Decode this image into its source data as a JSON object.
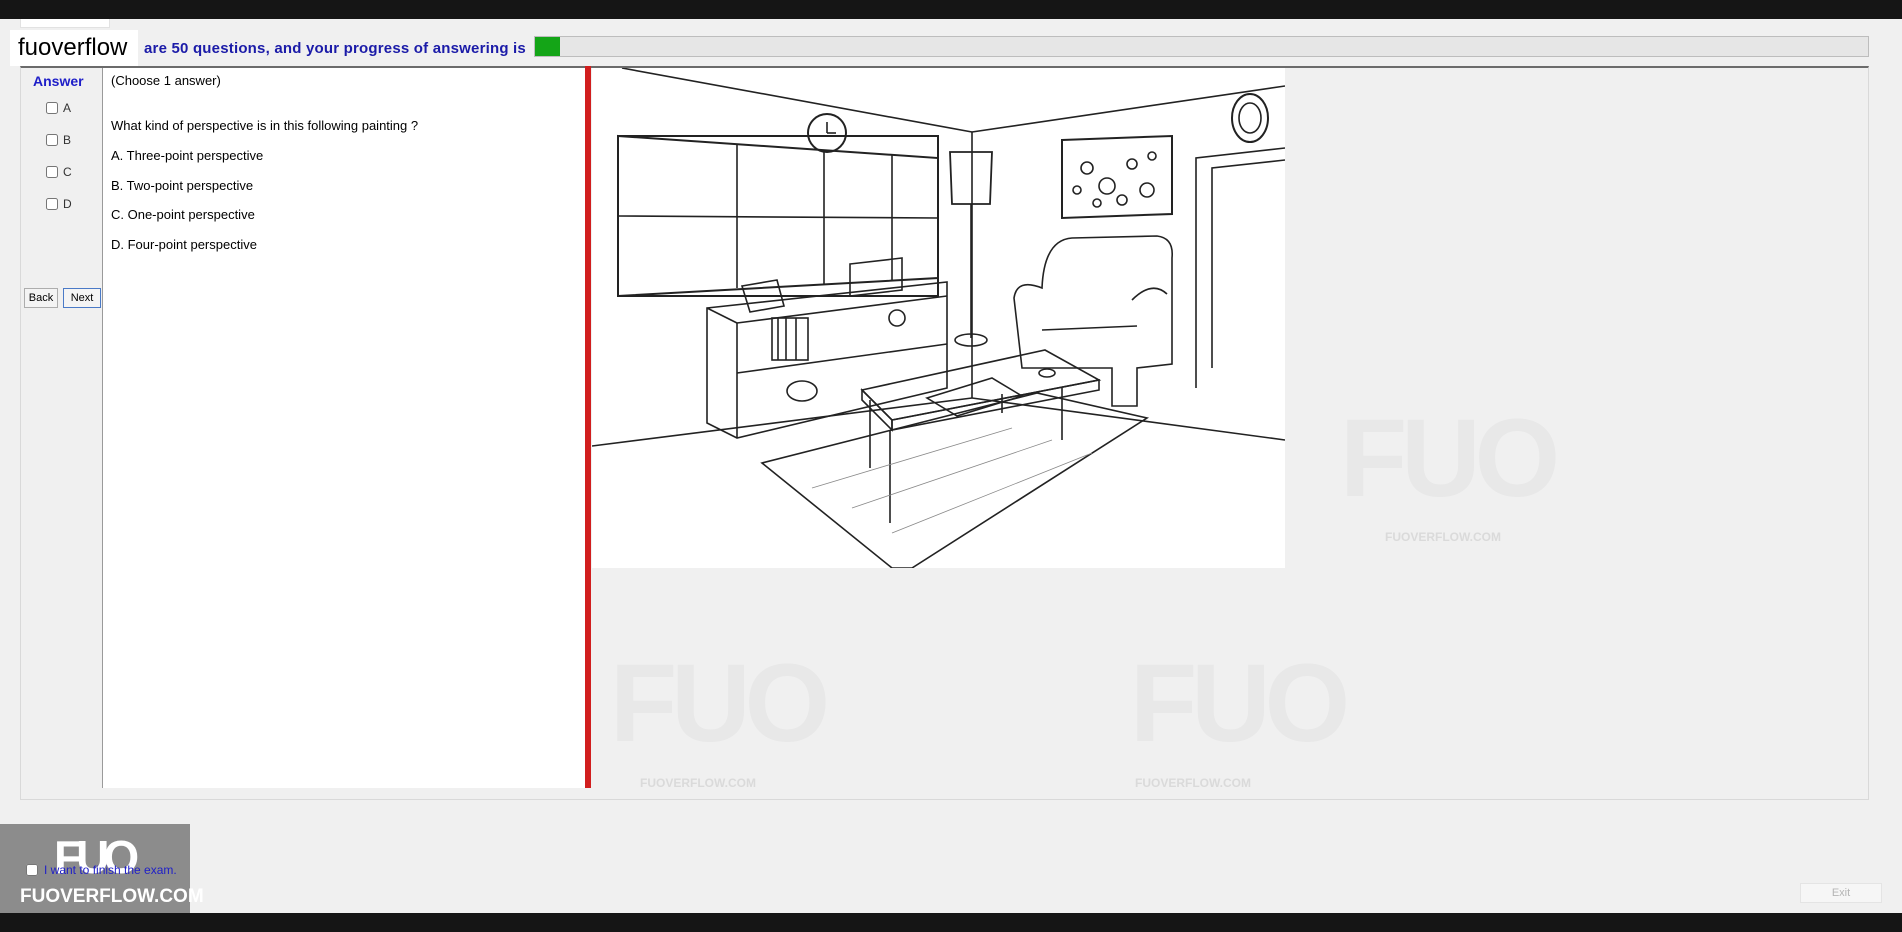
{
  "header": {
    "logo_text": "fuoverflow",
    "progress_text": "are 50 questions, and your progress of answering is",
    "progress_fraction": 0.019
  },
  "answer_panel": {
    "title": "Answer",
    "options": [
      {
        "key": "A",
        "checked": false
      },
      {
        "key": "B",
        "checked": false
      },
      {
        "key": "C",
        "checked": false
      },
      {
        "key": "D",
        "checked": false
      }
    ],
    "back_label": "Back",
    "next_label": "Next"
  },
  "question": {
    "instruction": "(Choose 1 answer)",
    "prompt": "What kind of perspective is in this following painting ?",
    "choices": [
      "A.  Three-point perspective",
      "B.  Two-point perspective",
      "C.  One-point perspective",
      "D.  Four-point perspective"
    ]
  },
  "watermark": {
    "logo": "FUO",
    "site": "FUOVERFLOW.COM"
  },
  "badge": {
    "mark": "FUO",
    "site": "FUOVERFLOW.COM"
  },
  "footer": {
    "finish_label": "I want to finish the exam.",
    "exit_label": "Exit"
  },
  "colors": {
    "progress_fill": "#14a517",
    "divider": "#d11e1e",
    "accent_text": "#1e1ec8"
  }
}
